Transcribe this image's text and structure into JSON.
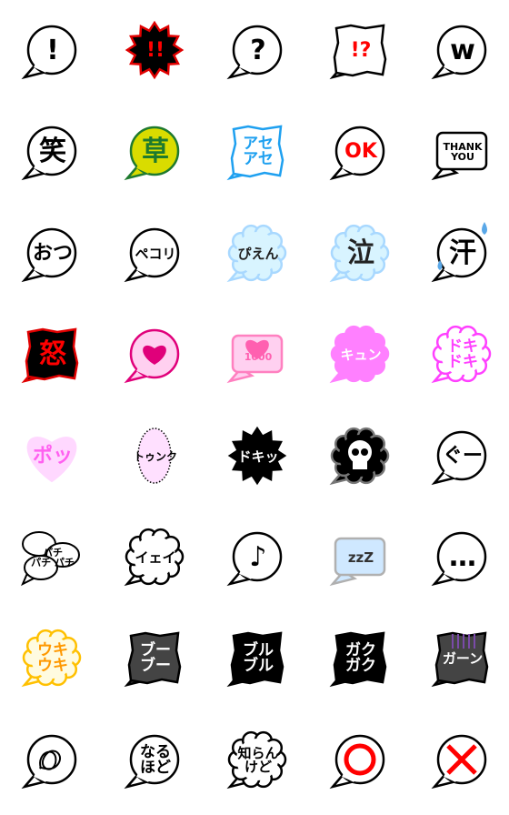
{
  "stickers": [
    {
      "text": "!",
      "shape": "circle",
      "fill": "#ffffff",
      "stroke": "#000000",
      "color": "#000000"
    },
    {
      "text": "!!",
      "shape": "burst",
      "fill": "#000000",
      "stroke": "#e00000",
      "color": "#ff0000"
    },
    {
      "text": "?",
      "shape": "circle",
      "fill": "#ffffff",
      "stroke": "#000000",
      "color": "#000000"
    },
    {
      "text": "!?",
      "shape": "jagged-rect",
      "fill": "#ffffff",
      "stroke": "#000000",
      "color": "#ff0000"
    },
    {
      "text": "w",
      "shape": "circle",
      "fill": "#ffffff",
      "stroke": "#000000",
      "color": "#000000"
    },
    {
      "text": "笑",
      "shape": "circle",
      "fill": "#ffffff",
      "stroke": "#000000",
      "color": "#000000"
    },
    {
      "text": "草",
      "shape": "circle",
      "fill": "#d9dc00",
      "stroke": "#1e7a2e",
      "color": "#1e7a2e"
    },
    {
      "text": "アセ\nアセ",
      "shape": "jagged-rect",
      "fill": "#ffffff",
      "stroke": "#1ea0f0",
      "color": "#1ea0f0"
    },
    {
      "text": "OK",
      "shape": "circle",
      "fill": "#ffffff",
      "stroke": "#000000",
      "color": "#ff0000"
    },
    {
      "text": "THANK\nYOU",
      "shape": "rect",
      "fill": "#ffffff",
      "stroke": "#000000",
      "color": "#000000"
    },
    {
      "text": "おつ",
      "shape": "circle",
      "fill": "#ffffff",
      "stroke": "#000000",
      "color": "#000000"
    },
    {
      "text": "ペコリ",
      "shape": "circle",
      "fill": "#ffffff",
      "stroke": "#000000",
      "color": "#000000"
    },
    {
      "text": "ぴえん",
      "shape": "cloud",
      "fill": "#d8f4ff",
      "stroke": "#a8d8ff",
      "color": "#222222"
    },
    {
      "text": "泣",
      "shape": "cloud",
      "fill": "#d8f4ff",
      "stroke": "#a8d8ff",
      "color": "#222222"
    },
    {
      "text": "汗",
      "shape": "circle",
      "fill": "#ffffff",
      "stroke": "#000000",
      "color": "#000000",
      "icon": "sweat-drops-icon"
    },
    {
      "text": "怒",
      "shape": "jagged-rect",
      "fill": "#000000",
      "stroke": "#e00000",
      "color": "#ff0000"
    },
    {
      "text": "",
      "shape": "circle",
      "fill": "#ffd0f0",
      "stroke": "#e0007a",
      "color": "#e0007a",
      "icon": "heart-icon"
    },
    {
      "text": "1000",
      "shape": "rect",
      "fill": "#ffd0f0",
      "stroke": "#ff80c0",
      "color": "#ff60b0",
      "icon": "heart-icon"
    },
    {
      "text": "キュン",
      "shape": "cloud",
      "fill": "#ff80ff",
      "stroke": "#ff80ff",
      "color": "#ffffff"
    },
    {
      "text": "ドキ\nドキ",
      "shape": "cloud",
      "fill": "#ffffff",
      "stroke": "#ff40ff",
      "color": "#ff40ff"
    },
    {
      "text": "ポッ",
      "shape": "heart",
      "fill": "#ffd8ff",
      "stroke": "#ffd8ff",
      "color": "#ff60f0"
    },
    {
      "text": "トゥンク",
      "shape": "oval",
      "fill": "#ffe0ff",
      "stroke": "#000000",
      "color": "#000000"
    },
    {
      "text": "ドキッ",
      "shape": "burst",
      "fill": "#000000",
      "stroke": "#000000",
      "color": "#ffffff"
    },
    {
      "text": "",
      "shape": "cloud",
      "fill": "#000000",
      "stroke": "#777777",
      "color": "#ffffff",
      "icon": "skull-icon"
    },
    {
      "text": "ぐー",
      "shape": "circle",
      "fill": "#ffffff",
      "stroke": "#000000",
      "color": "#000000"
    },
    {
      "text": "パチ\nパチ パチ",
      "shape": "multi-bubble",
      "fill": "#ffffff",
      "stroke": "#000000",
      "color": "#000000"
    },
    {
      "text": "イェイ",
      "shape": "cloud",
      "fill": "#ffffff",
      "stroke": "#000000",
      "color": "#000000"
    },
    {
      "text": "♪",
      "shape": "circle",
      "fill": "#ffffff",
      "stroke": "#000000",
      "color": "#000000"
    },
    {
      "text": "zzZ",
      "shape": "rect",
      "fill": "#cfe8ff",
      "stroke": "#b0b0b0",
      "color": "#333333"
    },
    {
      "text": "…",
      "shape": "circle",
      "fill": "#ffffff",
      "stroke": "#000000",
      "color": "#000000"
    },
    {
      "text": "ウキ\nウキ",
      "shape": "cloud",
      "fill": "#fffbe0",
      "stroke": "#ffc000",
      "color": "#ff9800"
    },
    {
      "text": "ブー\nブー",
      "shape": "jagged-rect",
      "fill": "#444444",
      "stroke": "#000000",
      "color": "#ffffff"
    },
    {
      "text": "ブル\nブル",
      "shape": "jagged-rect",
      "fill": "#000000",
      "stroke": "#000000",
      "color": "#ffffff"
    },
    {
      "text": "ガク\nガク",
      "shape": "jagged-rect",
      "fill": "#000000",
      "stroke": "#000000",
      "color": "#ffffff"
    },
    {
      "text": "ガーン",
      "shape": "jagged-rect",
      "fill": "#444444",
      "stroke": "#000000",
      "color": "#ffffff",
      "icon": "gloom-lines-icon"
    },
    {
      "text": "",
      "shape": "circle",
      "fill": "#ffffff",
      "stroke": "#000000",
      "color": "#000000",
      "icon": "scribble-icon"
    },
    {
      "text": "なる\nほど",
      "shape": "circle",
      "fill": "#ffffff",
      "stroke": "#000000",
      "color": "#000000"
    },
    {
      "text": "知らん\nけど",
      "shape": "cloud",
      "fill": "#ffffff",
      "stroke": "#000000",
      "color": "#000000"
    },
    {
      "text": "",
      "shape": "circle",
      "fill": "#ffffff",
      "stroke": "#000000",
      "color": "#ff0000",
      "icon": "circle-mark-icon"
    },
    {
      "text": "",
      "shape": "circle",
      "fill": "#ffffff",
      "stroke": "#000000",
      "color": "#ff0000",
      "icon": "cross-mark-icon"
    }
  ]
}
